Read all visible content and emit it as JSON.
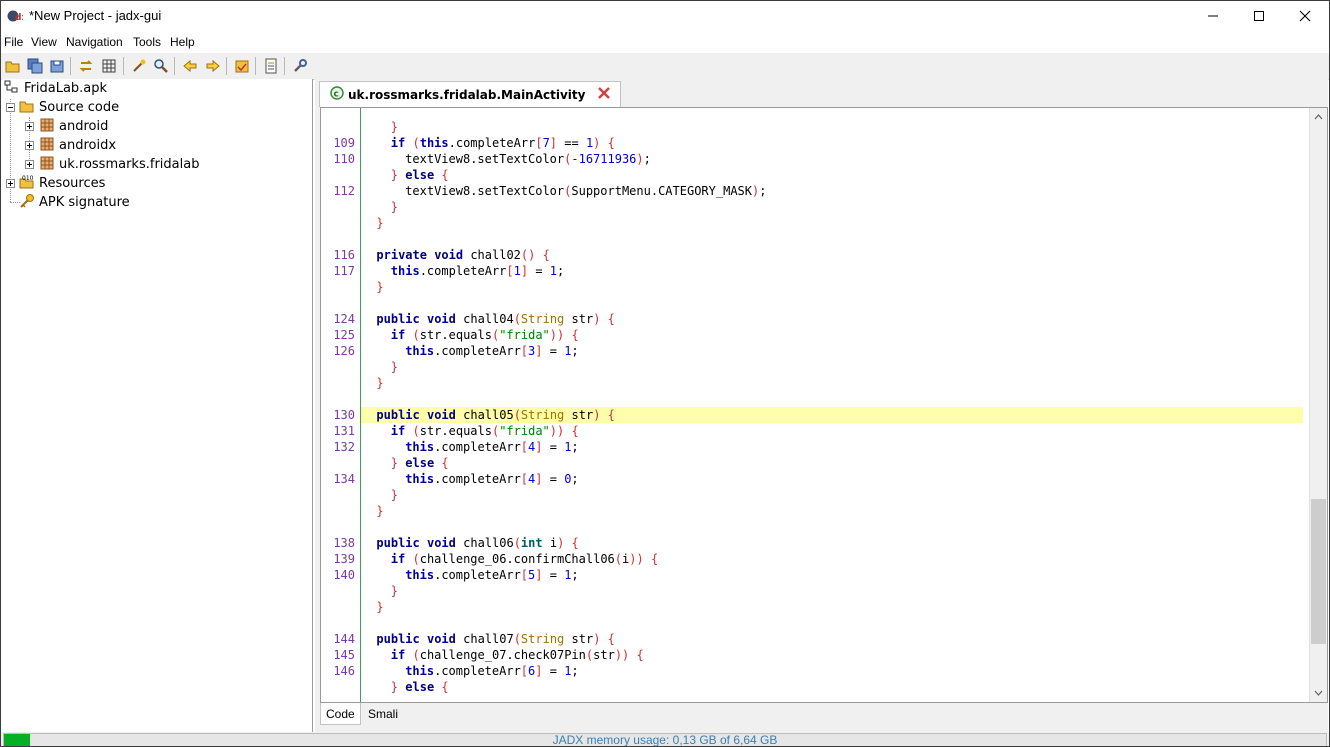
{
  "window": {
    "title": "*New Project - jadx-gui"
  },
  "menu": [
    "File",
    "View",
    "Navigation",
    "Tools",
    "Help"
  ],
  "tree": {
    "root": "FridaLab.apk",
    "source_code": "Source code",
    "packages": [
      "android",
      "androidx",
      "uk.rossmarks.fridalab"
    ],
    "resources": "Resources",
    "apk_signature": "APK signature"
  },
  "editor": {
    "tab_title": "uk.rossmarks.fridalab.MainActivity",
    "bottom_tabs": [
      "Code",
      "Smali"
    ],
    "highlighted_line": "130",
    "line_numbers": [
      "109",
      "110",
      "112",
      "116",
      "117",
      "124",
      "125",
      "126",
      "130",
      "131",
      "132",
      "134",
      "138",
      "139",
      "140",
      "144",
      "145",
      "146"
    ]
  },
  "status": {
    "memory_text": "JADX memory usage: 0,13 GB of 6,64 GB",
    "memory_fraction": 0.02
  },
  "colors": {
    "highlight": "#ffffaa",
    "gutter_border": "#3aa15a",
    "line_number": "#7a3b9a",
    "memory_fill": "#06b025",
    "memory_text": "#3c7fb1"
  }
}
